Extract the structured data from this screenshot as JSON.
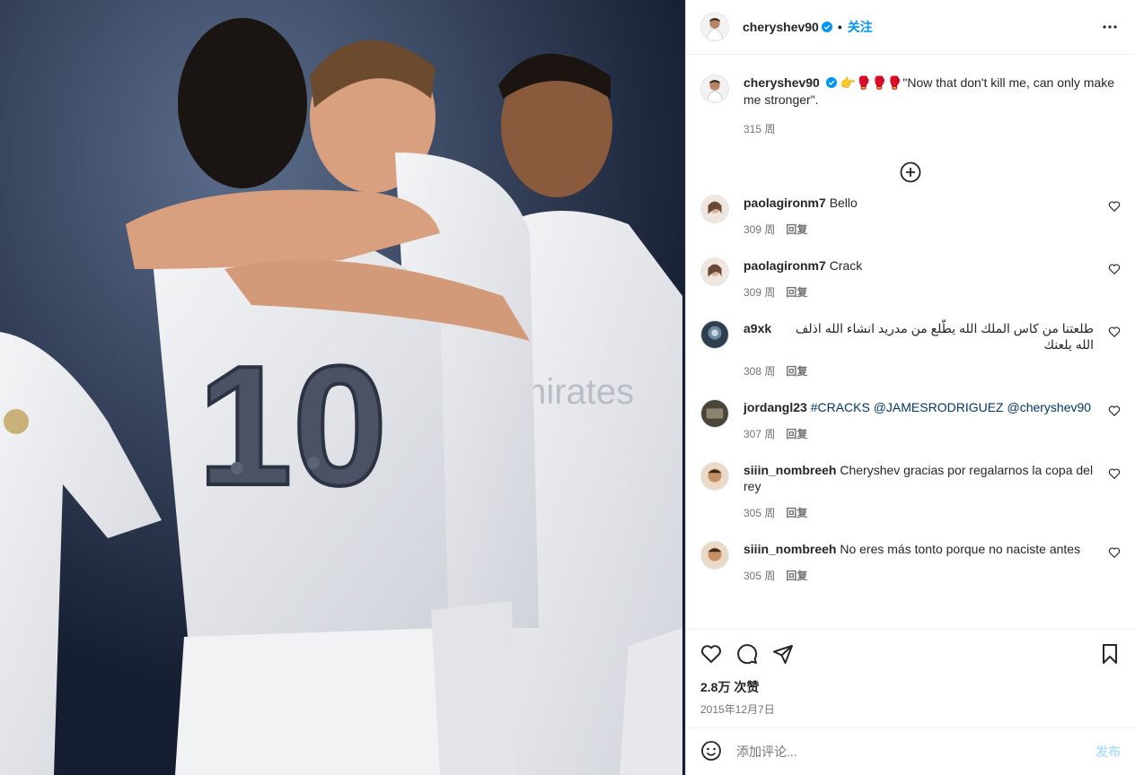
{
  "colors": {
    "accent": "#0095f6",
    "muted": "#737373",
    "text": "#262626",
    "border": "#dbdbdb"
  },
  "photo": {
    "alt_icon": "photo-content"
  },
  "header": {
    "username": "cheryshev90",
    "verified_icon": "verified-badge-icon",
    "separator": "•",
    "follow_label": "关注",
    "more_icon": "more-options-icon"
  },
  "caption": {
    "username": "cheryshev90",
    "emojis": "👉🥊🥊🥊",
    "text": "\"Now that don't kill me, can only make me stronger\".",
    "age": "315 周"
  },
  "load_more_icon": "plus-circle-icon",
  "comments": [
    {
      "username": "paolagironm7",
      "text": "Bello",
      "age": "309 周",
      "reply": "回复"
    },
    {
      "username": "paolagironm7",
      "text": "Crack",
      "age": "309 周",
      "reply": "回复"
    },
    {
      "username": "a9xk",
      "text": "طلعتنا من كاس الملك الله يطّلع من مدريد انشاء الله اذلف الله يلعنك",
      "age": "308 周",
      "reply": "回复"
    },
    {
      "username": "jordangl23",
      "text": "#CRACKS @JAMESRODRIGUEZ @cheryshev90",
      "age": "307 周",
      "reply": "回复"
    },
    {
      "username": "siiin_nombreeh",
      "text": "Cheryshev gracias por regalarnos la copa del rey",
      "age": "305 周",
      "reply": "回复"
    },
    {
      "username": "siiin_nombreeh",
      "text": "No eres más tonto porque no naciste antes",
      "age": "305 周",
      "reply": "回复"
    }
  ],
  "actions": {
    "like_icon": "heart-icon",
    "comment_icon": "comment-icon",
    "share_icon": "send-icon",
    "save_icon": "bookmark-icon",
    "likes": "2.8万 次赞",
    "date": "2015年12月7日"
  },
  "add_comment": {
    "emoji_icon": "emoji-icon",
    "placeholder": "添加评论...",
    "post_label": "发布"
  }
}
